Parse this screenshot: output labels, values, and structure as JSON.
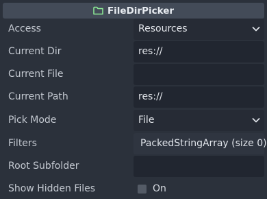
{
  "header": {
    "title": "FileDirPicker",
    "icon": "folder-icon",
    "icon_color": "#8eef97"
  },
  "properties": {
    "access": {
      "label": "Access",
      "value": "Resources"
    },
    "current_dir": {
      "label": "Current Dir",
      "value": "res://"
    },
    "current_file": {
      "label": "Current File",
      "value": ""
    },
    "current_path": {
      "label": "Current Path",
      "value": "res://"
    },
    "pick_mode": {
      "label": "Pick Mode",
      "value": "File"
    },
    "filters": {
      "label": "Filters",
      "value": "PackedStringArray (size 0)"
    },
    "root_subfolder": {
      "label": "Root Subfolder",
      "value": ""
    },
    "show_hidden_files": {
      "label": "Show Hidden Files",
      "checkbox_label": "On",
      "checked": false
    }
  },
  "colors": {
    "panel_bg": "#2b313b",
    "header_bg": "#434b58",
    "field_bg": "#212630"
  }
}
